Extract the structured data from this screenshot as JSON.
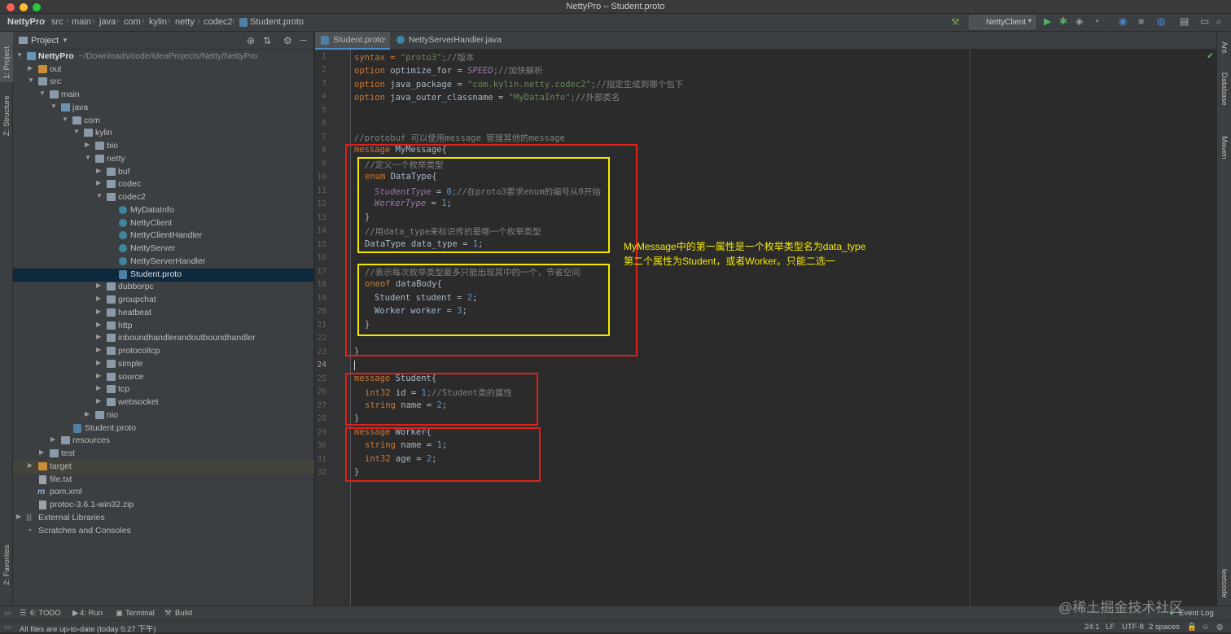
{
  "window": {
    "title": "NettyPro – Student.proto"
  },
  "breadcrumb": [
    "NettyPro",
    "src",
    "main",
    "java",
    "com",
    "kylin",
    "netty",
    "codec2",
    "Student.proto"
  ],
  "toolbar": {
    "run_config": "NettyClient"
  },
  "left_strip": {
    "project": "1: Project",
    "structure": "Z: Structure",
    "favorites": "2: Favorites"
  },
  "right_strip": {
    "ant": "Ant",
    "database": "Database",
    "maven": "Maven",
    "leetcode": "leetcode"
  },
  "project_panel": {
    "title": "Project",
    "tree": [
      {
        "label": "NettyPro",
        "path": "~/Downloads/code/IdeaProjects/Netty/NettyPro"
      },
      {
        "label": "out"
      },
      {
        "label": "src"
      },
      {
        "label": "main"
      },
      {
        "label": "java"
      },
      {
        "label": "com"
      },
      {
        "label": "kylin"
      },
      {
        "label": "bio"
      },
      {
        "label": "netty"
      },
      {
        "label": "buf"
      },
      {
        "label": "codec"
      },
      {
        "label": "codec2"
      },
      {
        "label": "MyDataInfo"
      },
      {
        "label": "NettyClient"
      },
      {
        "label": "NettyClientHandler"
      },
      {
        "label": "NettyServer"
      },
      {
        "label": "NettyServerHandler"
      },
      {
        "label": "Student.proto"
      },
      {
        "label": "dubborpc"
      },
      {
        "label": "groupchat"
      },
      {
        "label": "heatbeat"
      },
      {
        "label": "http"
      },
      {
        "label": "inboundhandlerandoutboundhandler"
      },
      {
        "label": "protocoltcp"
      },
      {
        "label": "simple"
      },
      {
        "label": "source"
      },
      {
        "label": "tcp"
      },
      {
        "label": "websocket"
      },
      {
        "label": "nio"
      },
      {
        "label": "Student.proto"
      },
      {
        "label": "resources"
      },
      {
        "label": "test"
      },
      {
        "label": "target"
      },
      {
        "label": "file.txt"
      },
      {
        "label": "pom.xml"
      },
      {
        "label": "protoc-3.6.1-win32.zip"
      },
      {
        "label": "External Libraries"
      },
      {
        "label": "Scratches and Consoles"
      }
    ]
  },
  "editor": {
    "tabs": [
      "Student.proto",
      "NettyServerHandler.java"
    ],
    "line_numbers": [
      "1",
      "2",
      "3",
      "4",
      "5",
      "6",
      "7",
      "8",
      "9",
      "10",
      "11",
      "12",
      "13",
      "14",
      "15",
      "16",
      "17",
      "18",
      "19",
      "20",
      "21",
      "22",
      "23",
      "24",
      "25",
      "26",
      "27",
      "28",
      "29",
      "30",
      "31",
      "32"
    ],
    "lines": {
      "l1a": "syntax = ",
      "l1b": "\"proto3\"",
      "l1c": ";//版本",
      "l2a": "option",
      "l2b": " optimize_for = ",
      "l2c": "SPEED",
      "l2d": ";//加快解析",
      "l3a": "option",
      "l3b": " java_package = ",
      "l3c": "\"com.kylin.netty.codec2\"",
      "l3d": ";//指定生成到哪个包下",
      "l4a": "option",
      "l4b": " java_outer_classname = ",
      "l4c": "\"MyDataInfo\"",
      "l4d": ";//外部类名",
      "l7": "//protobuf 可以使用message 管理其他的message",
      "l8a": "message",
      "l8b": " MyMessage{",
      "l9": "//定义一个枚举类型",
      "l10a": "enum",
      "l10b": " DataType{",
      "l11a": "StudentType",
      "l11b": " = ",
      "l11c": "0",
      "l11d": ";//在proto3要求enum的编号从0开始",
      "l12a": "WorkerType",
      "l12b": " = ",
      "l12c": "1",
      "l12d": ";",
      "l13": "}",
      "l14": "//用data_type来标识传的是哪一个枚举类型",
      "l15a": "DataType data_type = ",
      "l15b": "1",
      "l15c": ";",
      "l17": "//表示每次枚举类型最多只能出现其中的一个，节省空间",
      "l18a": "oneof",
      "l18b": " dataBody{",
      "l19a": "Student student = ",
      "l19b": "2",
      "l19c": ";",
      "l20a": "Worker worker = ",
      "l20b": "3",
      "l20c": ";",
      "l21": "}",
      "l23": "}",
      "l25a": "message",
      "l25b": " Student{",
      "l26a": "int32",
      "l26b": " id = ",
      "l26c": "1",
      "l26d": ";//Student类的属性",
      "l27a": "string",
      "l27b": " name = ",
      "l27c": "2",
      "l27d": ";",
      "l28": "}",
      "l29a": "message",
      "l29b": " Worker{",
      "l30a": "string",
      "l30b": " name = ",
      "l30c": "1",
      "l30d": ";",
      "l31a": "int32",
      "l31b": " age = ",
      "l31c": "2",
      "l31d": ";",
      "l32": "}"
    }
  },
  "annotation": {
    "line1": "MyMessage中的第一属性是一个枚举类型名为data_type",
    "line2": "第二个属性为Student，或者Worker。只能二选一"
  },
  "bottom_tools": {
    "todo": "6: TODO",
    "run": "4: Run",
    "terminal": "Terminal",
    "build": "Build",
    "event_log": "Event Log"
  },
  "status": {
    "message": "All files are up-to-date (today 5:27 下午)",
    "position": "24:1",
    "line_sep": "LF",
    "encoding": "UTF-8",
    "indent": "2 spaces"
  },
  "watermark": "@稀土掘金技术社区",
  "colors": {
    "keyword": "#cc7832",
    "string": "#6a8759",
    "comment": "#808080",
    "number": "#6897bb",
    "enum_const": "#9876aa",
    "red_box": "#e0201a",
    "yellow_box": "#f5e800"
  }
}
